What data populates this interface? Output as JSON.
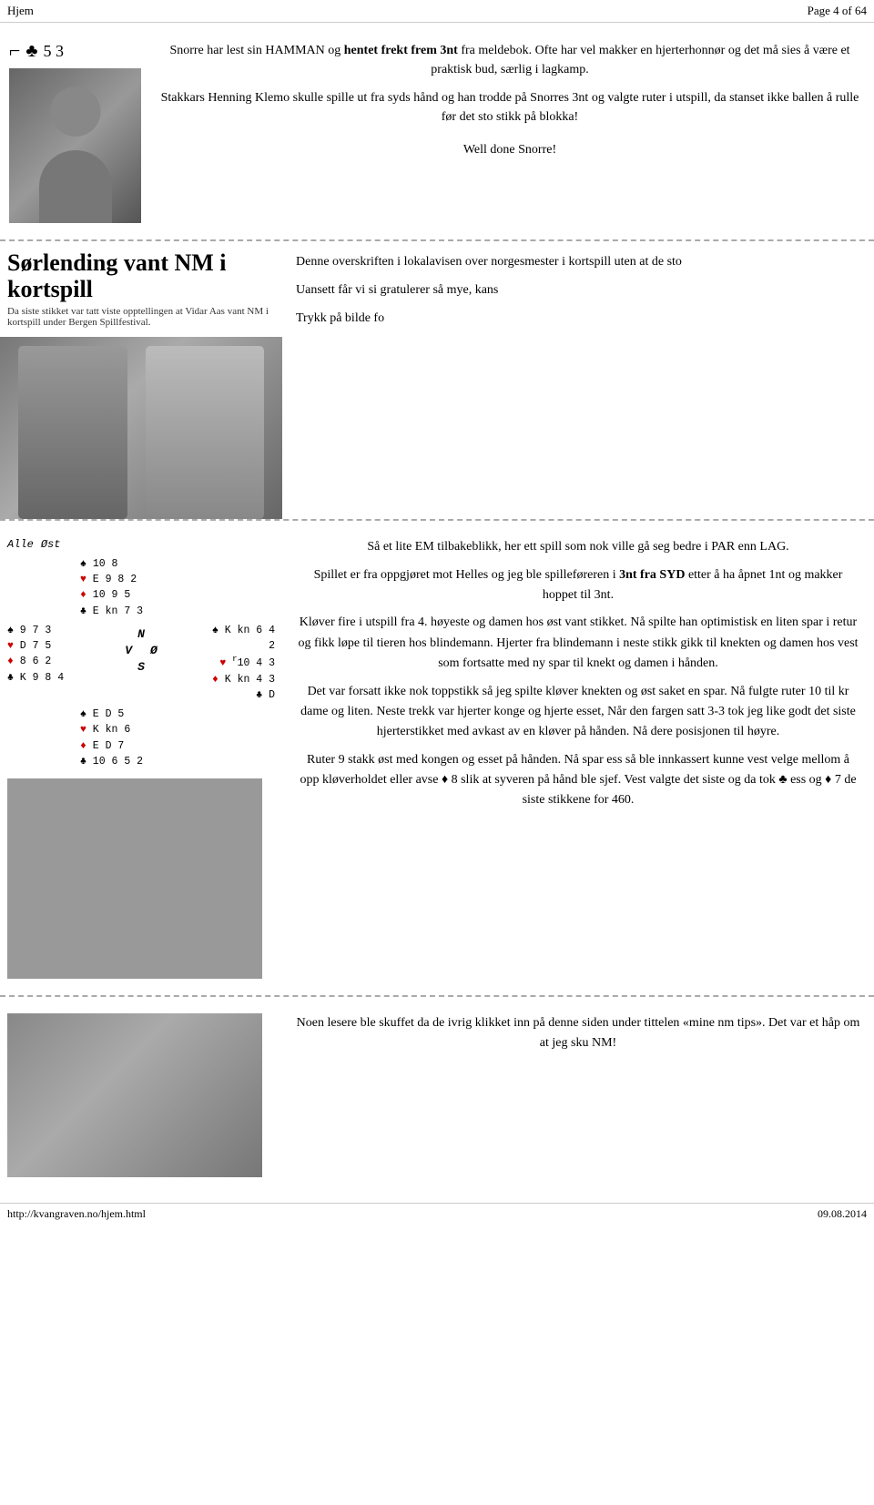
{
  "header": {
    "left": "Hjem",
    "right": "Page 4 of 64"
  },
  "section1": {
    "card_bracket": "⌐",
    "club_symbol": "♣",
    "card_numbers": "5 3",
    "text1": "Snorre har lest sin HAMMAN og ",
    "text1_bold": "hentet frekt frem 3nt",
    "text1_rest": " fra meldebok. Ofte har vel makker en hjerterhonnør og det må sies å være et praktisk bud, særlig i lagkamp.",
    "text2": "Stakkars Henning Klemo skulle spille ut fra syds hånd og han trodde på Snorres 3nt og valgte ruter i utspill, da stanset ikke ballen å rulle før det sto stikk på blokka!",
    "text3": "Well done Snorre!"
  },
  "section2": {
    "headline_title": "Sørlending vant NM i kortspill",
    "headline_subtitle": "Da siste stikket var tatt viste opptellingen at Vidar Aas vant NM i kortspill under Bergen Spillfestival.",
    "text1": "Denne overskriften i lokalavisen over norgesmester i kortspill uten at de sto",
    "text2": "Uansett får vi si gratulerer så mye, kans",
    "text3": "Trykk på bilde fo"
  },
  "section3": {
    "alle_label": "Alle",
    "ost_label": "Øst",
    "north_spade": "♠ 10 8",
    "north_heart": "♥ E 9 8 2",
    "north_diamond": "♦ 10 9 5",
    "north_club": "♣ E kn 7 3",
    "west_spade": "♠ 9 7 3",
    "west_heart": "♥ D 7 5",
    "west_diamond": "♦ 8 6 2",
    "west_club": "♣ K 9 8 4",
    "east_spade": "♠ K kn 6 4 2",
    "east_heart": "♥ 10 4 3",
    "east_diamond": "♦ K kn 4 3",
    "east_club": "♣ D",
    "south_spade": "♠ E D 5",
    "south_heart": "♥ K kn 6",
    "south_diamond": "♦ E D 7",
    "south_club": "♣ 10 6 5 2",
    "N": "N",
    "V": "V",
    "O": "Ø",
    "S": "S",
    "text1": "Så et lite EM tilbakeblikk, her ett spill som nok ville gå seg bedre i PAR enn LAG.",
    "text2": "Spillet er fra oppgjøret mot Helles og jeg ble spilleføreren i ",
    "text2_bold": "3nt fra SYD",
    "text2_rest": " etter å ha åpnet 1nt og makker hoppet til 3nt.",
    "text3": "Kløver fire i utspill fra 4. høyeste og damen hos øst vant stikket. Nå spilte han optimistisk en liten spar i retur og fikk løpe til tieren hos blindemann. Hjerter fra blindemann i neste stikk gikk til knekten og damen hos vest som fortsatte med ny spar til knekt og damen i hånden.",
    "text4": "Det var forsatt ikke nok toppstikk så jeg spilte kløver knekten og øst saket en spar. Nå fulgte ruter 10 til kr dame og liten. Neste trekk var hjerter konge og hjerte esset, Når den fargen satt 3-3 tok jeg like godt det siste hjerterstikket med avkast av en kløver på hånden. Nå dere posisjonen til høyre.",
    "text5": "Ruter 9 stakk øst med kongen og esset på hånden. Nå spar ess så ble innkassert kunne vest velge mellom å opp kløverholdet eller avse ♦ 8 slik at syveren på hånd ble sjef. Vest valgte det siste og da tok ♣ ess og ♦ 7 de siste stikkene for 460."
  },
  "section4": {
    "text1": "Noen lesere ble skuffet da de ivrig klikket inn på denne siden under tittelen «mine nm tips». Det var et håp om at jeg sku NM!"
  },
  "footer": {
    "url": "http://kvangraven.no/hjem.html",
    "date": "09.08.2014"
  }
}
